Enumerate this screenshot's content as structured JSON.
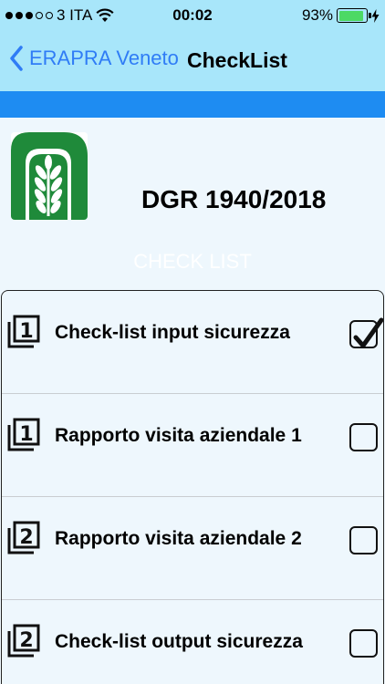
{
  "status_bar": {
    "carrier": "3 ITA",
    "time": "00:02",
    "battery_percent": "93%",
    "battery_level": 0.93
  },
  "nav": {
    "back_label": "ERAPRA Veneto",
    "title": "CheckList"
  },
  "header": {
    "document_title": "DGR 1940/2018",
    "section_heading": "CHECK LIST"
  },
  "checklist": {
    "items": [
      {
        "number": "1",
        "label": "Check-list input sicurezza",
        "checked": true
      },
      {
        "number": "1",
        "label": "Rapporto visita aziendale 1",
        "checked": false
      },
      {
        "number": "2",
        "label": "Rapporto visita aziendale 2",
        "checked": false
      },
      {
        "number": "2",
        "label": "Check-list output sicurezza",
        "checked": false
      }
    ]
  },
  "colors": {
    "nav_bg": "#a8e6fa",
    "stripe": "#1e8cf2",
    "accent": "#2f7cf6",
    "page_bg": "#eef7fd",
    "logo_green": "#1f8a3a",
    "battery_green": "#4cd964"
  },
  "icons": {
    "wifi": "wifi-icon",
    "back": "chevron-left-icon",
    "battery": "battery-icon",
    "charging": "bolt-icon",
    "list_item": "stacked-number-icon",
    "check": "checkmark-icon"
  }
}
